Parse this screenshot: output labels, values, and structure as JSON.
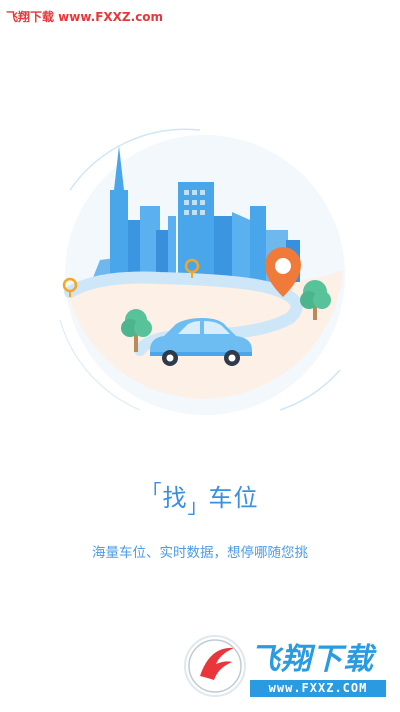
{
  "watermark": {
    "site_label": "飞翔下载 www.FXXZ.com"
  },
  "onboarding": {
    "title_bracketed": "找",
    "title_rest": "车位",
    "subtitle": "海量车位、实时数据，想停哪随您挑"
  },
  "logo": {
    "name": "飞翔下载",
    "url": "www.FXXZ.COM"
  },
  "colors": {
    "accent": "#3a8fe0",
    "pin": "#f07a3a",
    "watermark_red": "#e8363a",
    "logo_blue": "#2a9be0"
  }
}
